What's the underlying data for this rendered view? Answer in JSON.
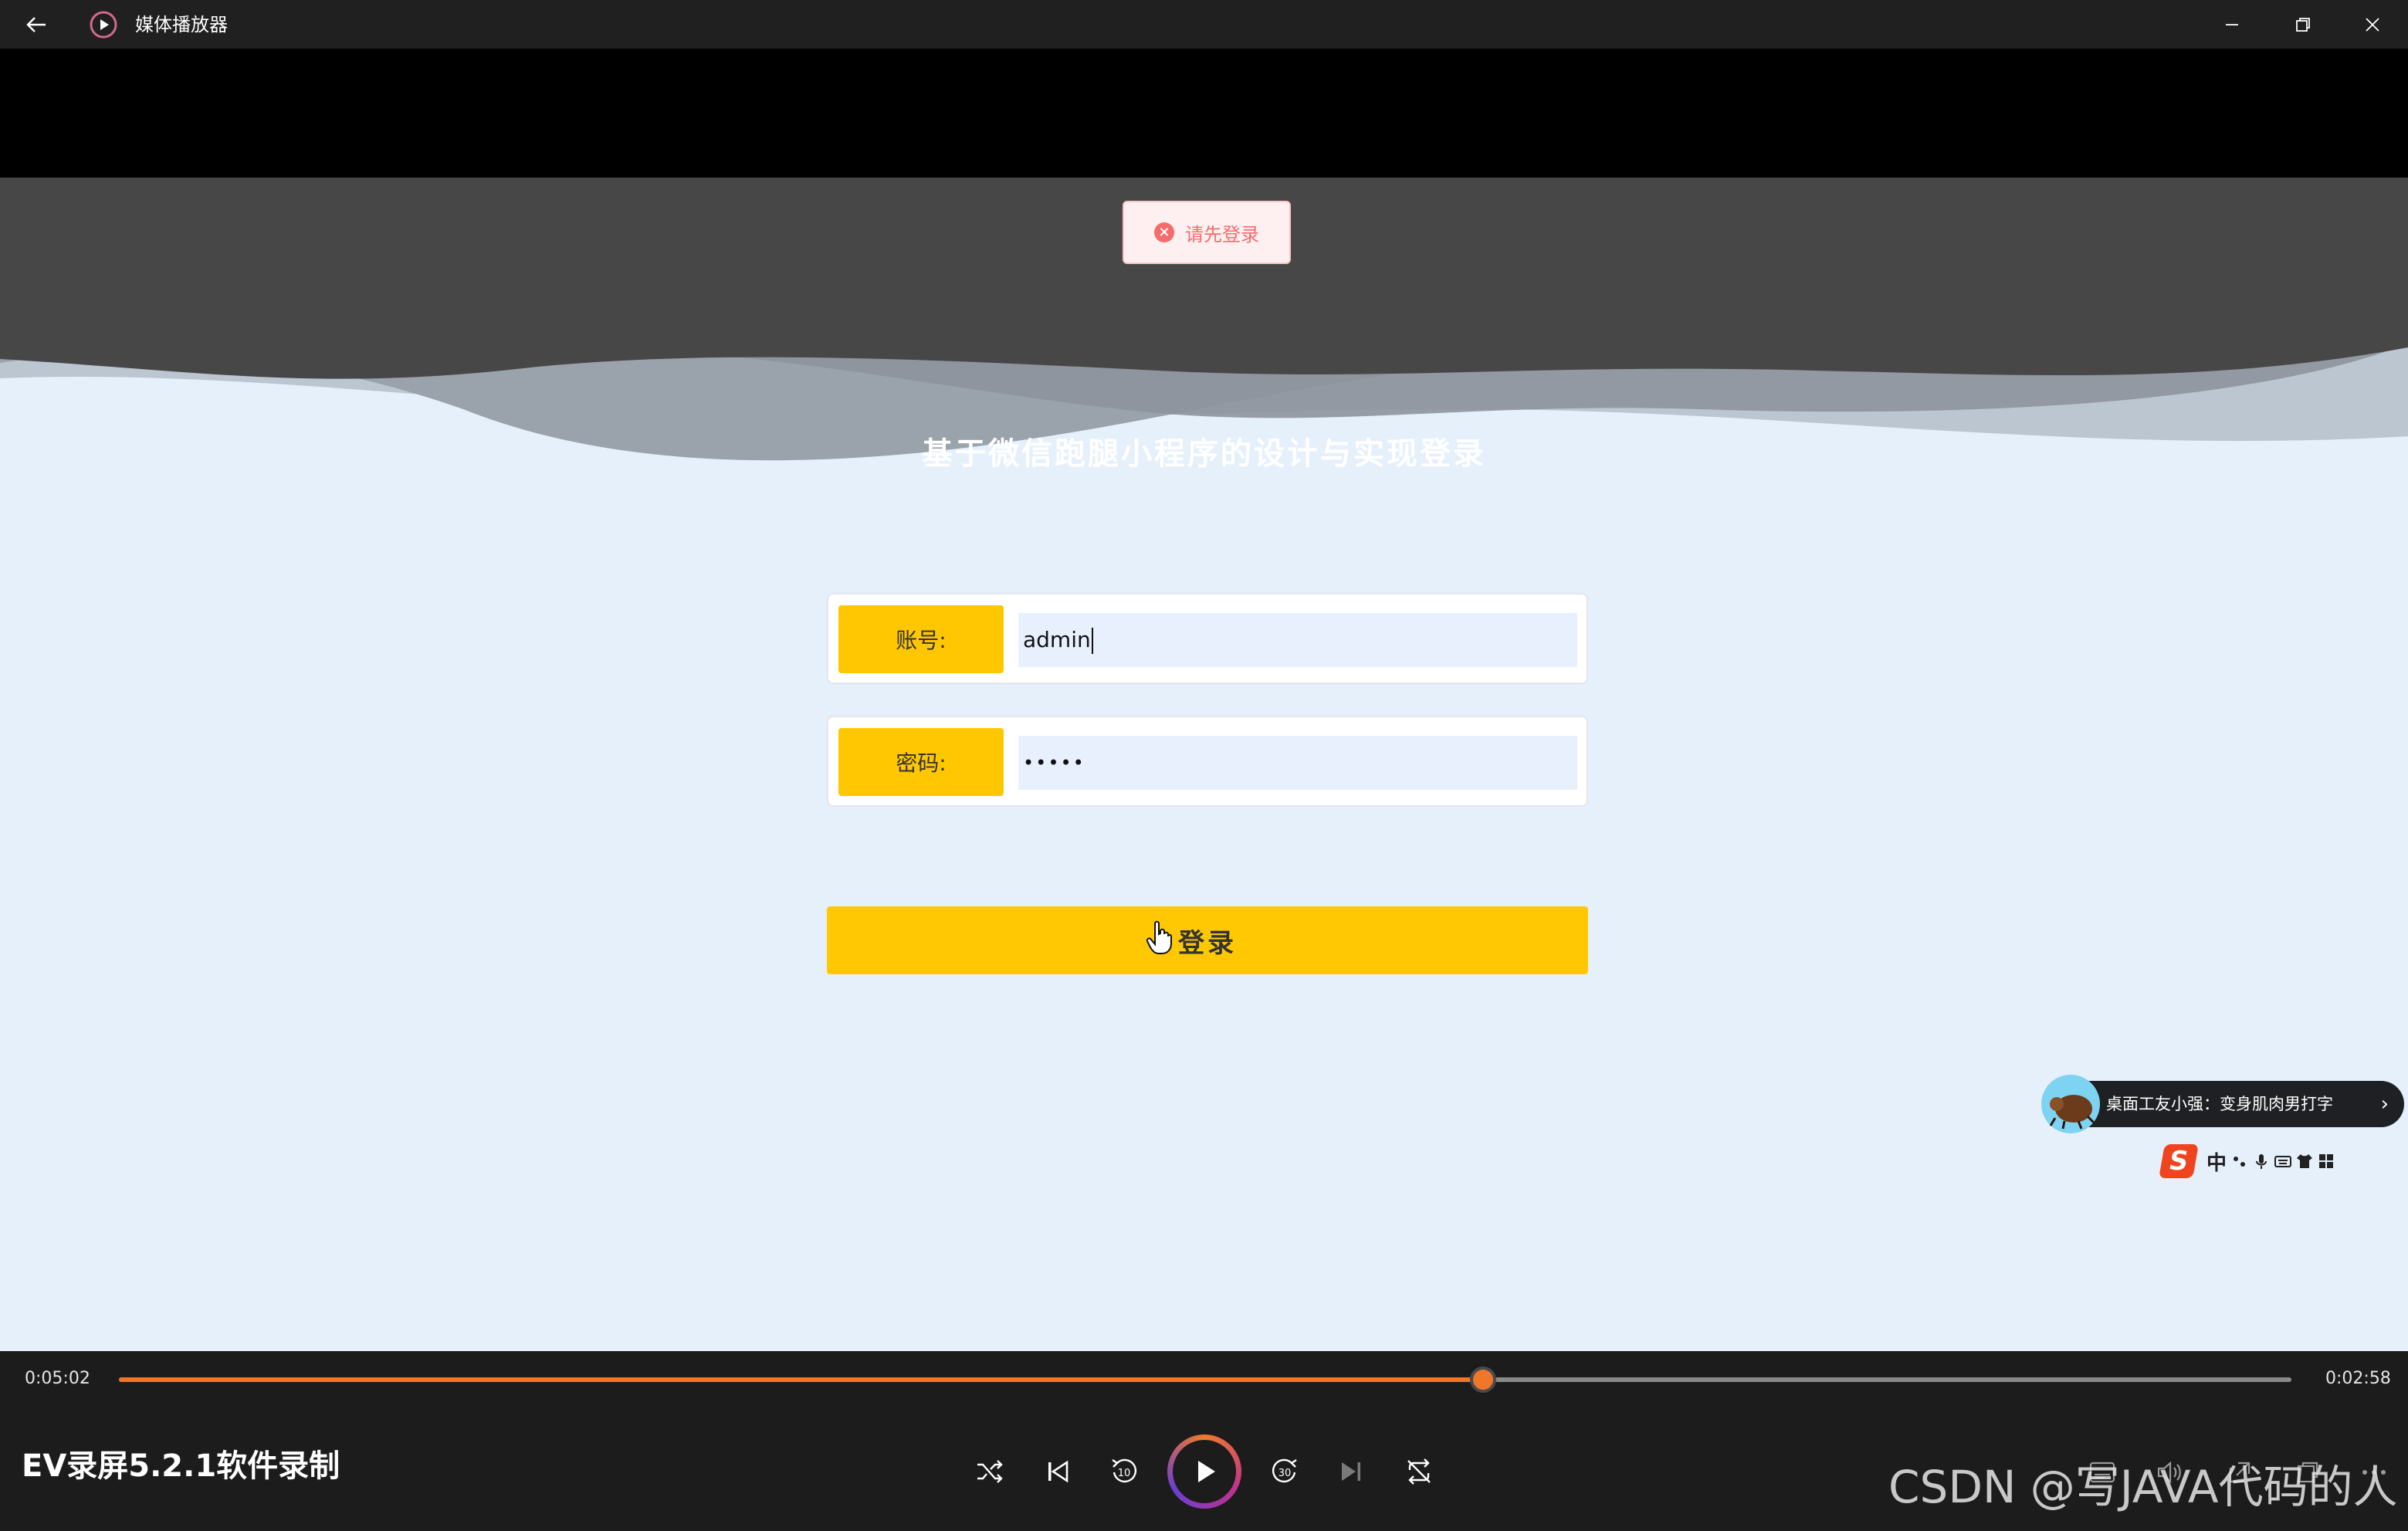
{
  "titlebar": {
    "app_title": "媒体播放器",
    "icons": [
      "back-arrow-icon",
      "media-player-app-icon",
      "minimize-icon",
      "restore-icon",
      "close-icon"
    ]
  },
  "toast": {
    "message": "请先登录",
    "icon": "error-circle-icon",
    "color": "#f56c6c"
  },
  "login": {
    "title": "基于微信跑腿小程序的设计与实现登录",
    "account_label": "账号:",
    "account_value": "admin",
    "password_label": "密码:",
    "password_value": "•••••",
    "submit_label": "登录",
    "accent_color": "#ffc802"
  },
  "desktop_pet": {
    "text": "桌面工友小强：变身肌肉男打字",
    "arrow": "›"
  },
  "ime_toolbar": {
    "brand": "S",
    "mode": "中",
    "icons": [
      "punctuation-icon",
      "microphone-icon",
      "keyboard-icon",
      "skin-icon",
      "apps-grid-icon"
    ]
  },
  "player": {
    "elapsed": "0:05:02",
    "remaining": "0:02:58",
    "progress": 0.628,
    "media_title": "EV录屏5.2.1软件录制",
    "accent_color": "#f0762a",
    "controls": [
      "shuffle-icon",
      "previous-icon",
      "rewind-10-icon",
      "play-icon",
      "forward-30-icon",
      "next-icon",
      "repeat-icon"
    ],
    "right_controls": [
      "subtitles-icon",
      "volume-icon",
      "cast-icon",
      "fullscreen-icon",
      "more-icon"
    ]
  },
  "watermark": "CSDN @写JAVA代码的人"
}
